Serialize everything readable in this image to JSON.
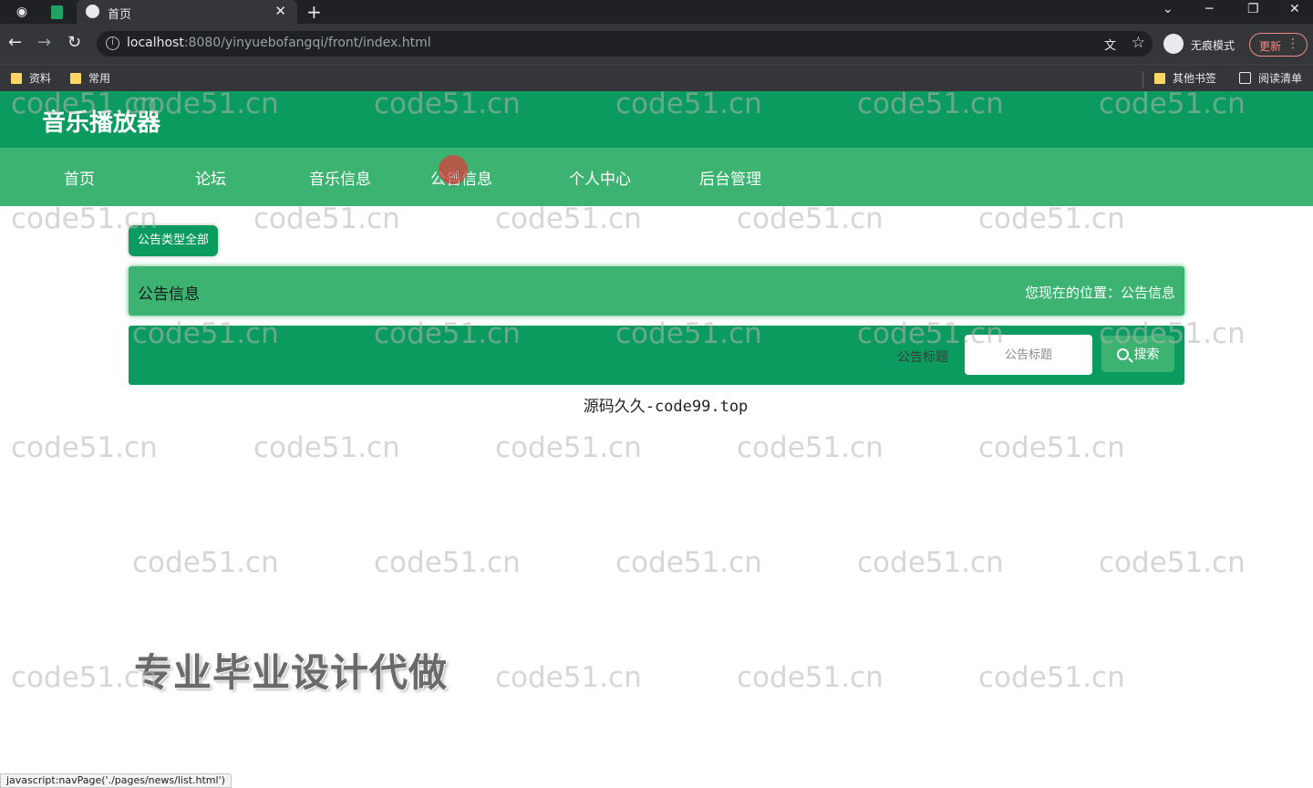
{
  "browser": {
    "tab_title": "首页",
    "url_host": "localhost",
    "url_rest": ":8080/yinyuebofangqi/front/index.html",
    "incognito_label": "无痕模式",
    "update_label": "更新",
    "bookmarks": [
      "资料",
      "常用"
    ],
    "bookmarks_right": [
      "其他书签",
      "阅读清单"
    ],
    "status_url": "javascript:navPage('./pages/news/list.html')"
  },
  "site": {
    "title": "音乐播放器",
    "nav": [
      "首页",
      "论坛",
      "音乐信息",
      "公告信息",
      "个人中心",
      "后台管理"
    ]
  },
  "page": {
    "type_filter": "公告类型全部",
    "section_title": "公告信息",
    "location": "您现在的位置：公告信息",
    "search_label": "公告标题",
    "search_placeholder": "公告标题",
    "search_button": "搜索"
  },
  "overlay_text": "源码久久-code99.top",
  "promo_text": "专业毕业设计代做",
  "watermark": "code51.cn",
  "colors": {
    "primary": "#0c9b5e",
    "secondary": "#3cb371"
  }
}
